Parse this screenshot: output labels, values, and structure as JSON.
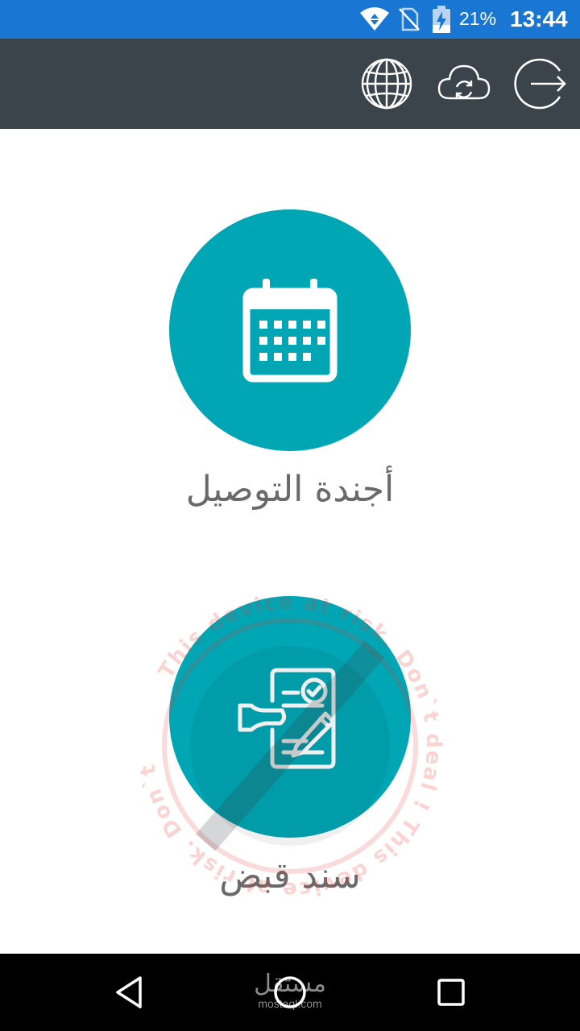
{
  "status_bar": {
    "battery_percent": "21%",
    "time": "13:44",
    "icons": [
      "wifi-icon",
      "no-sim-icon",
      "battery-charging-icon"
    ],
    "color": "#1976d2"
  },
  "toolbar": {
    "color": "#3b434b",
    "icons": [
      "globe-icon",
      "cloud-sync-icon",
      "logout-icon"
    ]
  },
  "menu": {
    "accent_color": "#00a6b4",
    "items": [
      {
        "label": "أجندة التوصيل",
        "icon": "calendar-icon"
      },
      {
        "label": "سند قبض",
        "icon": "receipt-document-icon"
      }
    ]
  },
  "watermark": {
    "text": "This device at risk. Don`t deal ! This device at risk. Don`t deal !",
    "color": "#e53935"
  },
  "nav_bar": {
    "icons": [
      "back-icon",
      "home-icon",
      "recent-apps-icon"
    ],
    "brand_arabic": "مستقل",
    "brand_url": "mostaql.com"
  }
}
